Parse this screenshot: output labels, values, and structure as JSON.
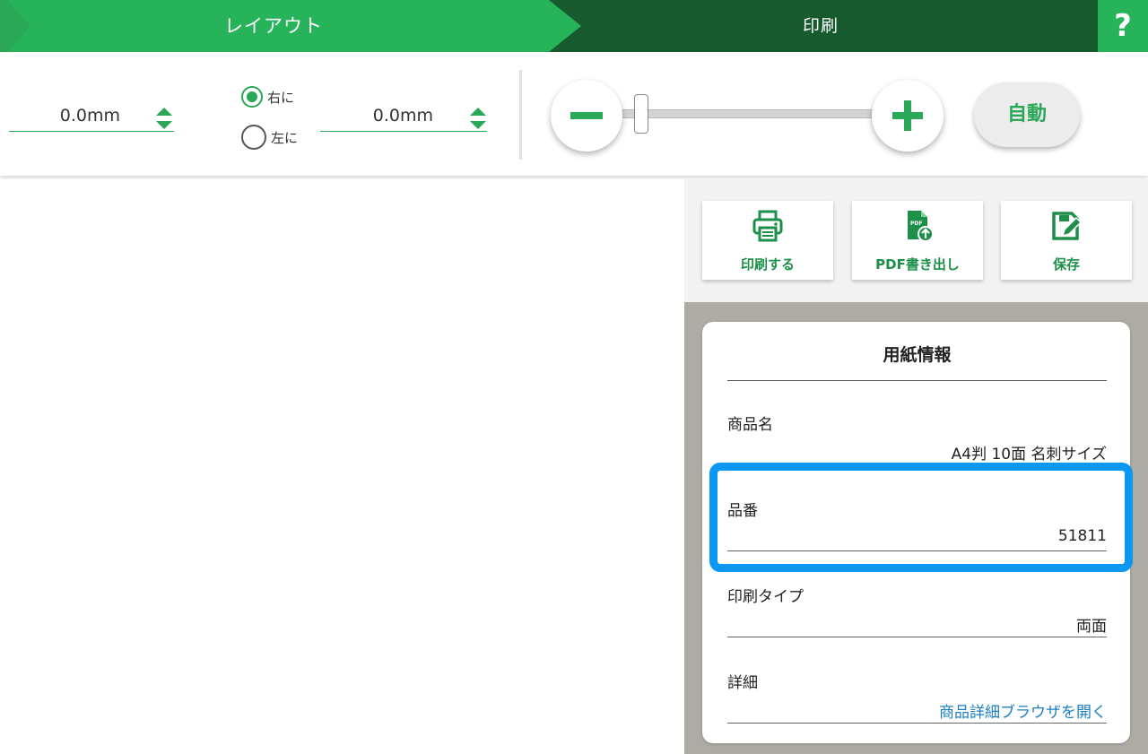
{
  "steps": {
    "layout_label": "レイアウト",
    "print_label": "印刷",
    "help_label": "?"
  },
  "toolbar": {
    "offset_field_1": "0.0mm",
    "radio_right_label": "右に",
    "radio_left_label": "左に",
    "radio_selected": "右に",
    "offset_field_2": "0.0mm",
    "zoom_level": 0.07,
    "auto_label": "自動"
  },
  "actions": [
    {
      "label": "印刷する",
      "icon": "printer-icon"
    },
    {
      "label": "PDF書き出し",
      "icon": "pdf-export-icon"
    },
    {
      "label": "保存",
      "icon": "save-icon"
    }
  ],
  "paper_info": {
    "title": "用紙情報",
    "rows": [
      {
        "label": "商品名",
        "value": "A4判 10面 名刺サイズ"
      },
      {
        "label": "品番",
        "value": "51811"
      },
      {
        "label": "印刷タイプ",
        "value": "両面"
      },
      {
        "label": "詳細",
        "value": "商品詳細ブラウザを開く"
      }
    ]
  },
  "colors": {
    "accent": "#27b35a",
    "dark_green": "#165a2d",
    "highlight": "#0b97f2",
    "link": "#1b7fc1"
  }
}
